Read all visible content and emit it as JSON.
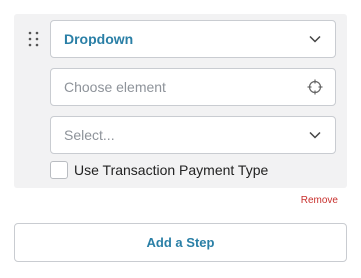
{
  "step": {
    "type_select": {
      "value": "Dropdown",
      "icon": "chevron-down-icon"
    },
    "element_picker": {
      "placeholder": "Choose element",
      "icon": "crosshair-icon"
    },
    "value_select": {
      "placeholder": "Select...",
      "icon": "chevron-down-icon"
    },
    "checkbox": {
      "label": "Use Transaction Payment Type",
      "checked": false
    },
    "drag_icon": "drag-handle-icon",
    "remove_label": "Remove"
  },
  "add_step": {
    "label": "Add a Step"
  },
  "colors": {
    "accent": "#2a7fa6",
    "danger": "#c8302d",
    "card_background": "#f2f2f3",
    "border": "#c9ccd1",
    "placeholder": "#8e939a"
  }
}
